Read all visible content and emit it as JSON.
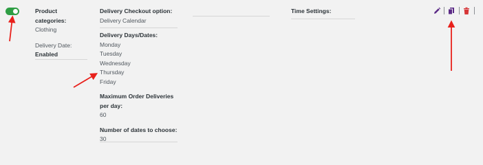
{
  "row": {
    "enabled_toggle": "on",
    "product_categories_label": "Product categories:",
    "product_categories_value": "Clothing",
    "delivery_date_label": "Delivery Date:",
    "delivery_date_value": "Enabled",
    "checkout_option_label": "Delivery Checkout option:",
    "checkout_option_value": "Delivery Calendar",
    "delivery_days_label": "Delivery Days/Dates:",
    "delivery_days": [
      "Monday",
      "Tuesday",
      "Wednesday",
      "Thursday",
      "Friday"
    ],
    "max_orders_label": "Maximum Order Deliveries per day:",
    "max_orders_value": "60",
    "num_dates_label": "Number of dates to choose:",
    "num_dates_value": "30",
    "time_settings_label": "Time Settings:"
  },
  "icons": {
    "edit": "pencil-icon",
    "copy": "copy-icon",
    "delete": "trash-icon"
  },
  "colors": {
    "toggle_on": "#2e9e44",
    "icon_purple": "#5b2a86",
    "icon_red": "#d63638",
    "annotation_arrow": "#e8201b"
  }
}
